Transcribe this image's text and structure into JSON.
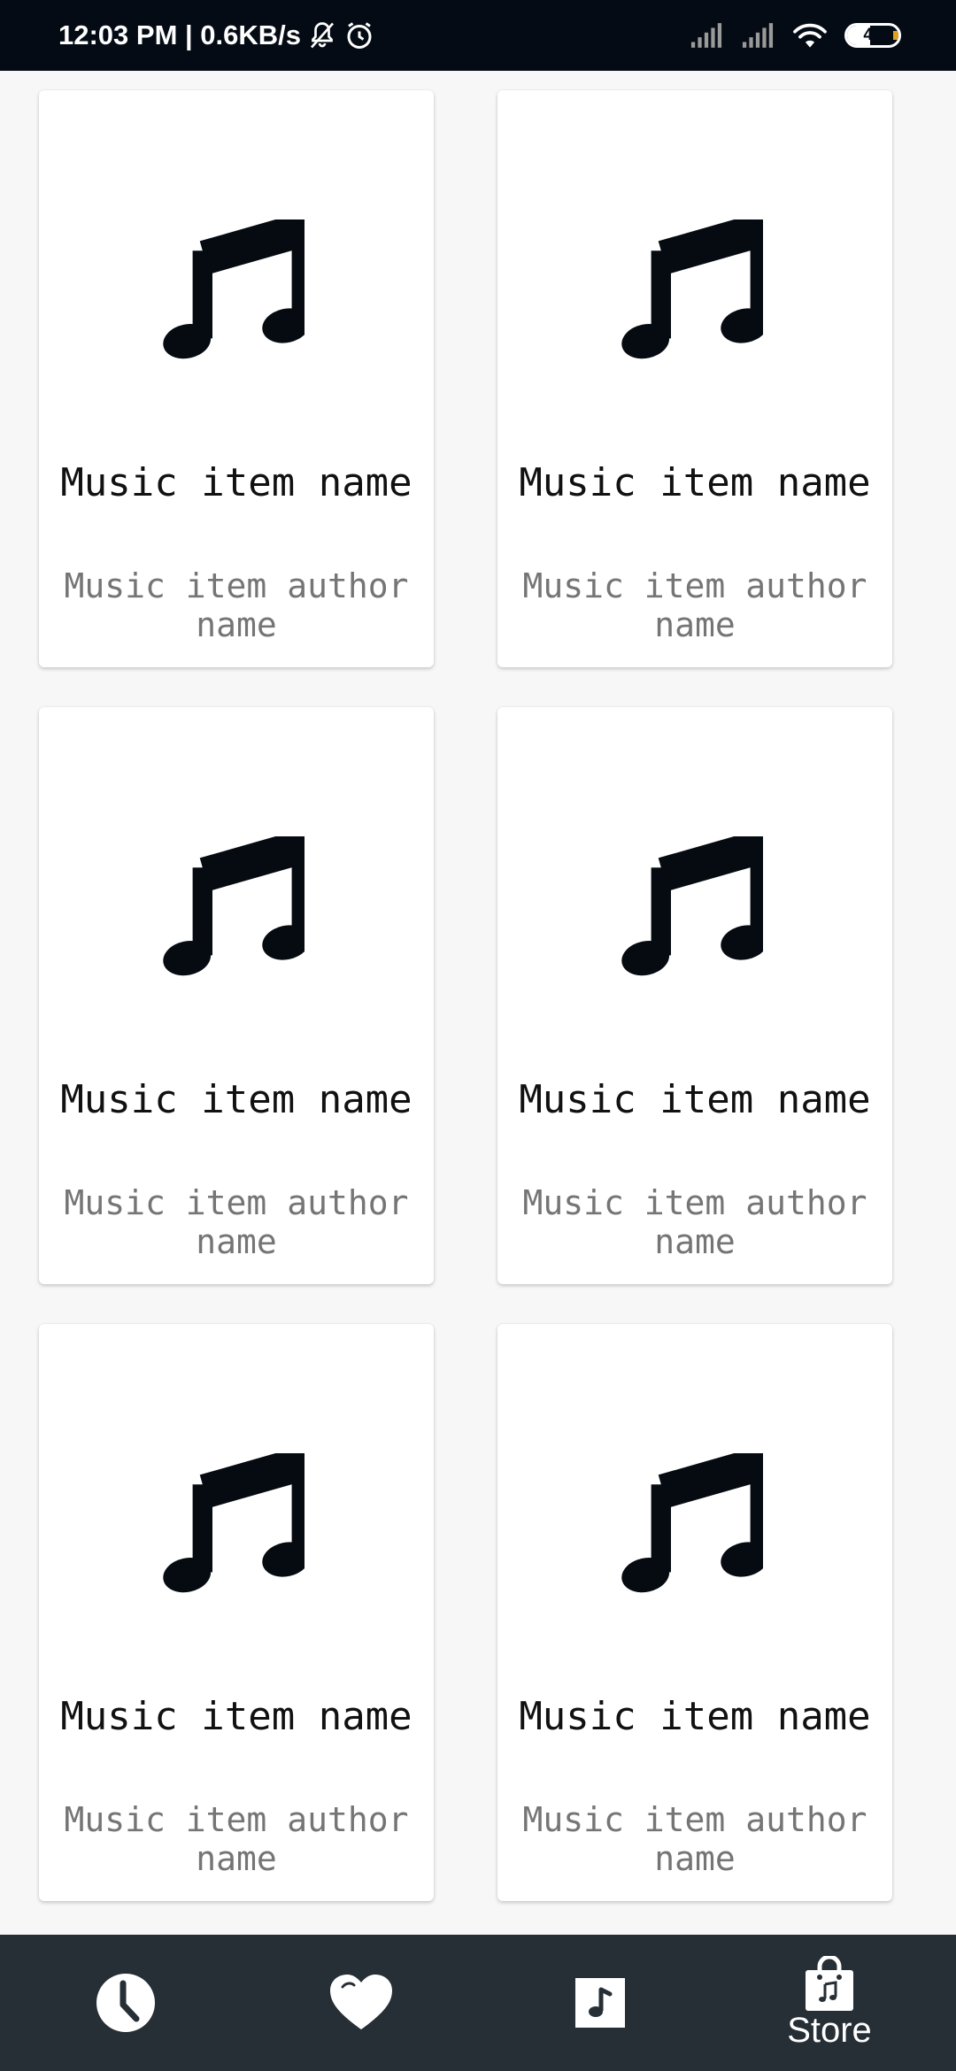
{
  "status_bar": {
    "time_speed": "12:03 PM | 0.6KB/s",
    "battery_level": "44",
    "battery_fraction": 0.44,
    "icons": [
      "mute-icon",
      "alarm-icon",
      "signal-icon",
      "signal-icon",
      "wifi-icon",
      "battery-icon"
    ]
  },
  "items": [
    {
      "name": "Music item name",
      "author": "Music item author name",
      "icon": "music-note-icon"
    },
    {
      "name": "Music item name",
      "author": "Music item author name",
      "icon": "music-note-icon"
    },
    {
      "name": "Music item name",
      "author": "Music item author name",
      "icon": "music-note-icon"
    },
    {
      "name": "Music item name",
      "author": "Music item author name",
      "icon": "music-note-icon"
    },
    {
      "name": "Music item name",
      "author": "Music item author name",
      "icon": "music-note-icon"
    },
    {
      "name": "Music item name",
      "author": "Music item author name",
      "icon": "music-note-icon"
    }
  ],
  "bottom_nav": {
    "items": [
      {
        "icon": "clock-icon",
        "label": ""
      },
      {
        "icon": "heart-icon",
        "label": ""
      },
      {
        "icon": "music-box-icon",
        "label": ""
      },
      {
        "icon": "shopping-bag-icon",
        "label": "Store",
        "active": true
      }
    ]
  },
  "colors": {
    "status_bar_bg": "#040b14",
    "page_bg": "#f7f7f7",
    "nav_bg": "#262e36",
    "title_text": "#111111",
    "author_text": "#757575",
    "battery_accent": "#e0a21d"
  }
}
